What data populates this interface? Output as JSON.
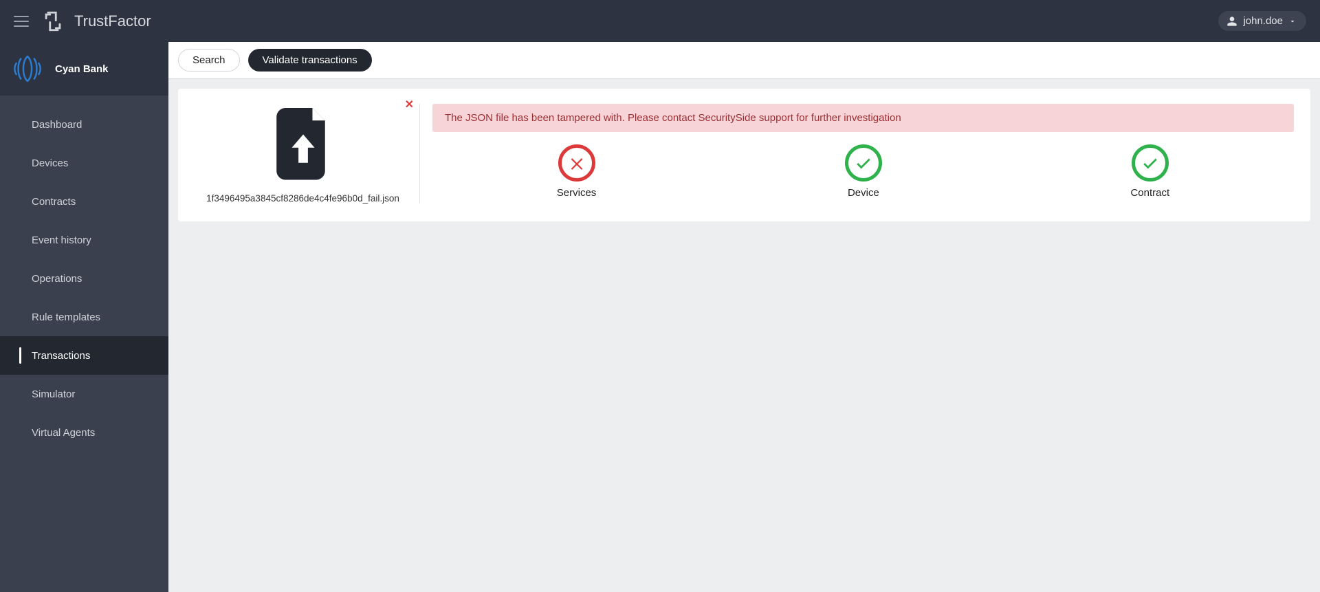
{
  "header": {
    "brand": "TrustFactor",
    "user": "john.doe"
  },
  "sidebar": {
    "org": "Cyan Bank",
    "items": [
      {
        "label": "Dashboard",
        "active": false
      },
      {
        "label": "Devices",
        "active": false
      },
      {
        "label": "Contracts",
        "active": false
      },
      {
        "label": "Event history",
        "active": false
      },
      {
        "label": "Operations",
        "active": false
      },
      {
        "label": "Rule templates",
        "active": false
      },
      {
        "label": "Transactions",
        "active": true
      },
      {
        "label": "Simulator",
        "active": false
      },
      {
        "label": "Virtual Agents",
        "active": false
      }
    ]
  },
  "tabs": [
    {
      "label": "Search",
      "style": "light"
    },
    {
      "label": "Validate transactions",
      "style": "dark"
    }
  ],
  "upload": {
    "filename": "1f3496495a3845cf8286de4c4fe96b0d_fail.json"
  },
  "alert": {
    "message": "The JSON file has been tampered with. Please contact SecuritySide support for further investigation"
  },
  "statuses": [
    {
      "label": "Services",
      "state": "fail"
    },
    {
      "label": "Device",
      "state": "ok"
    },
    {
      "label": "Contract",
      "state": "ok"
    }
  ],
  "colors": {
    "fail": "#dc3a3a",
    "ok": "#2fb24c"
  }
}
